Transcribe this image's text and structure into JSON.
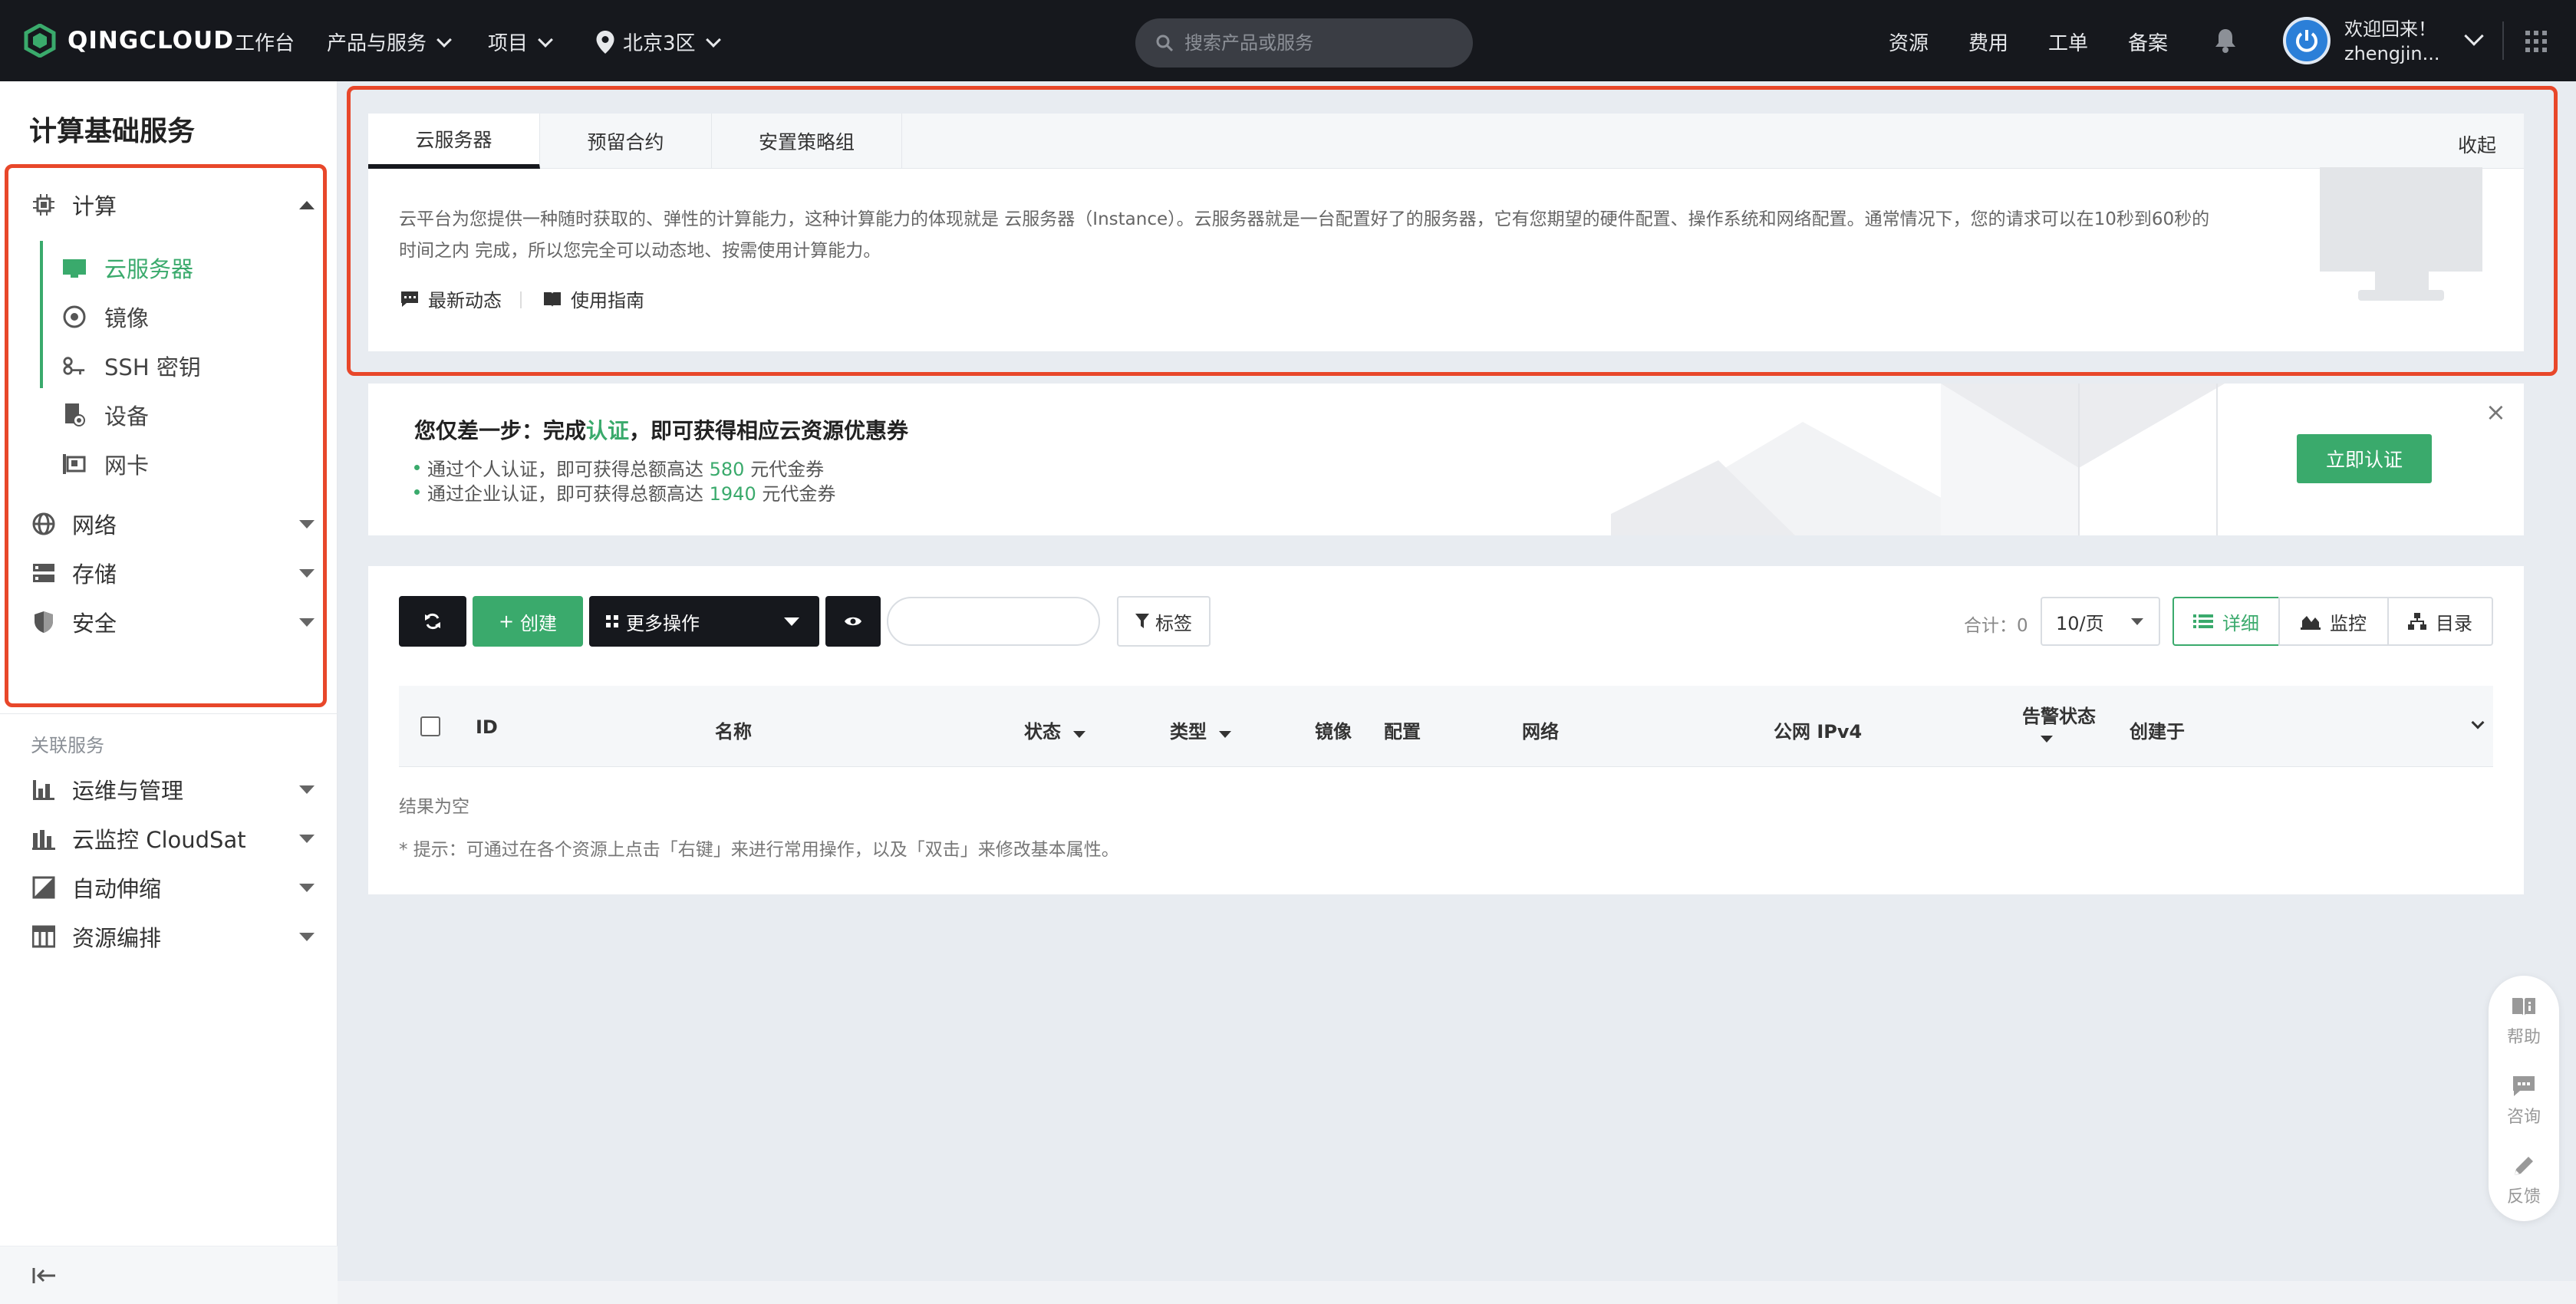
{
  "topbar": {
    "logo_text": "QINGCLOUD",
    "nav": [
      "工作台",
      "产品与服务",
      "项目",
      "北京3区"
    ],
    "search_placeholder": "搜索产品或服务",
    "links": [
      "资源",
      "费用",
      "工单",
      "备案"
    ],
    "welcome": "欢迎回来！",
    "username": "zhengjin..."
  },
  "sidebar": {
    "title": "计算基础服务",
    "compute": {
      "label": "计算",
      "items": [
        {
          "label": "云服务器",
          "active": true
        },
        {
          "label": "镜像"
        },
        {
          "label": "SSH 密钥"
        },
        {
          "label": "设备"
        },
        {
          "label": "网卡"
        }
      ]
    },
    "groups": [
      "网络",
      "存储",
      "安全"
    ],
    "related_label": "关联服务",
    "related": [
      "运维与管理",
      "云监控 CloudSat",
      "自动伸缩",
      "资源编排"
    ]
  },
  "intro": {
    "tabs": [
      "云服务器",
      "预留合约",
      "安置策略组"
    ],
    "collapse": "收起",
    "description": "云平台为您提供一种随时获取的、弹性的计算能力，这种计算能力的体现就是 云服务器（Instance）。云服务器就是一台配置好了的服务器，它有您期望的硬件配置、操作系统和网络配置。通常情况下，您的请求可以在10秒到60秒的时间之内 完成，所以您完全可以动态地、按需使用计算能力。",
    "links": [
      "最新动态",
      "使用指南"
    ]
  },
  "banner": {
    "title_pre": "您仅差一步：完成",
    "title_highlight": "认证",
    "title_post": "，即可获得相应云资源优惠券",
    "line1_pre": "通过个人认证，即可获得总额高达 ",
    "line1_amount": "580",
    "line1_post": " 元代金券",
    "line2_pre": "通过企业认证，即可获得总额高达 ",
    "line2_amount": "1940",
    "line2_post": " 元代金券",
    "button": "立即认证",
    "close": "×"
  },
  "toolbar": {
    "create": "创建",
    "more": "更多操作",
    "tag": "标签",
    "total": "合计：0",
    "per_page": "10/页",
    "views": [
      "详细",
      "监控",
      "目录"
    ]
  },
  "table": {
    "columns": [
      "ID",
      "名称",
      "状态",
      "类型",
      "镜像",
      "配置",
      "网络",
      "公网 IPv4",
      "告警状态",
      "创建于"
    ],
    "empty": "结果为空",
    "hint": "* 提示：可通过在各个资源上点击「右键」来进行常用操作，以及「双击」来修改基本属性。"
  },
  "float_help": [
    "帮助",
    "咨询",
    "反馈"
  ],
  "colors": {
    "accent": "#3aaa6c",
    "topbar": "#16181d",
    "highlight_box": "#e8472a"
  }
}
